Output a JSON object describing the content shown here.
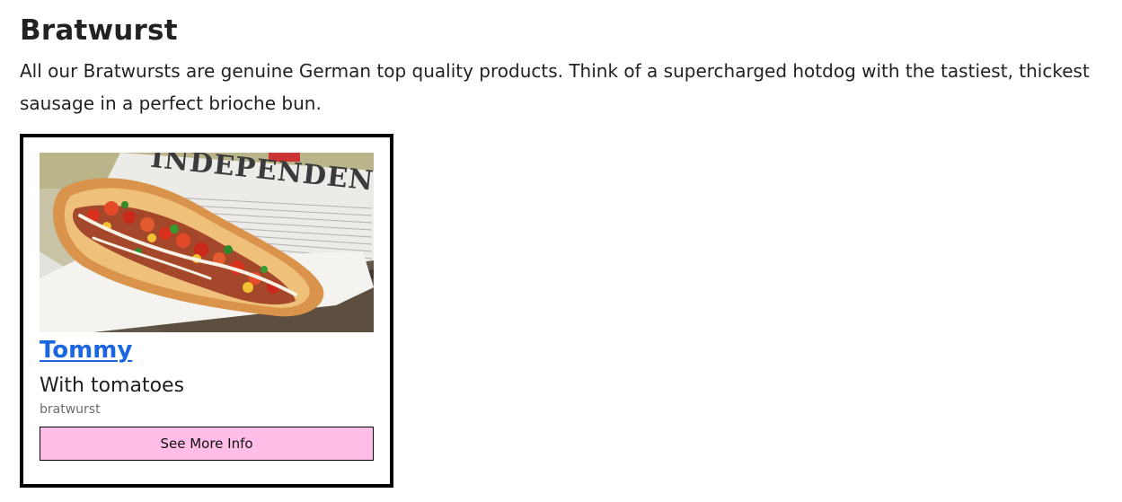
{
  "section": {
    "title": "Bratwurst",
    "description": "All our Bratwursts are genuine German top quality products. Think of a supercharged hotdog with the tastiest, thickest sausage in a perfect brioche bun."
  },
  "card": {
    "image_alt": "Hotdog with tomatoes on newspaper",
    "newspaper_text": "INDEPENDENT",
    "title": "Tommy",
    "subtitle": "With tomatoes",
    "category": "bratwurst",
    "button_label": "See More Info",
    "colors": {
      "title_link": "#1a66e0",
      "button_bg": "#ffbde8",
      "border": "#000000"
    }
  }
}
